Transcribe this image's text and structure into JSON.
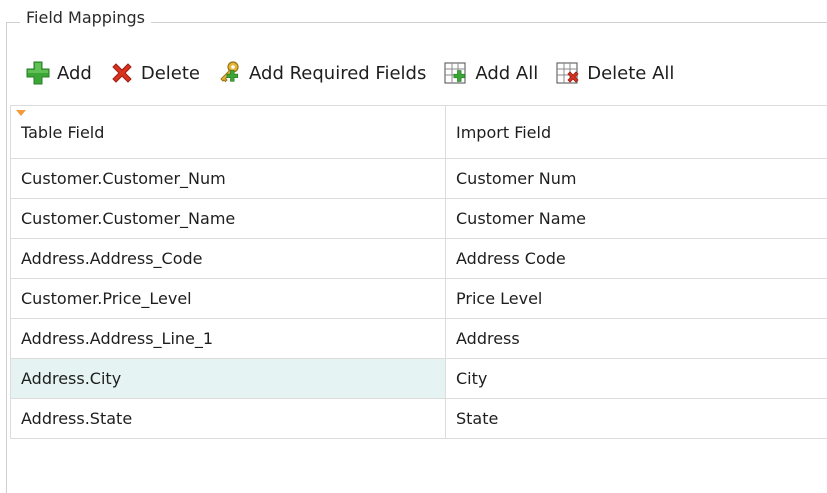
{
  "group": {
    "title": "Field Mappings"
  },
  "toolbar": {
    "add": "Add",
    "delete": "Delete",
    "add_required": "Add Required Fields",
    "add_all": "Add All",
    "delete_all": "Delete All"
  },
  "grid": {
    "headers": [
      "Table Field",
      "Import Field"
    ],
    "rows": [
      [
        "Customer.Customer_Num",
        "Customer Num"
      ],
      [
        "Customer.Customer_Name",
        "Customer Name"
      ],
      [
        "Address.Address_Code",
        "Address Code"
      ],
      [
        "Customer.Price_Level",
        "Price Level"
      ],
      [
        "Address.Address_Line_1",
        "Address"
      ],
      [
        "Address.City",
        "City"
      ],
      [
        "Address.State",
        "State"
      ]
    ],
    "selected_row": 5
  },
  "colors": {
    "add_green": "#3aa635",
    "delete_red": "#d9301f",
    "selected_row": "#e5f4f2",
    "sort_indicator": "#f29a3c"
  }
}
